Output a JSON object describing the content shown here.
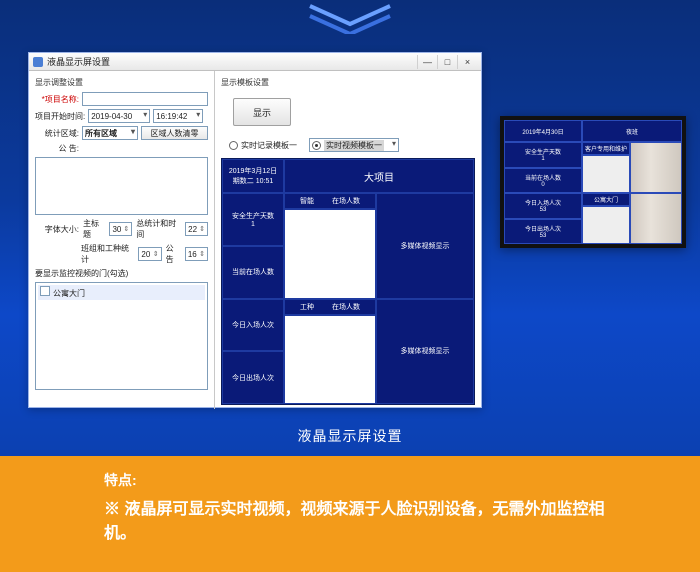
{
  "window": {
    "title": "液晶显示屏设置",
    "minimize": "—",
    "maximize": "□",
    "close": "×"
  },
  "left": {
    "group": "显示调整设置",
    "project_name_lbl": "*项目名称:",
    "date_lbl": "项目开始时间:",
    "date": "2019-04-30",
    "time": "16:19:42",
    "area_lbl": "统计区域:",
    "area": "所有区域",
    "area_clear": "区域人数清零",
    "notice_lbl": "公   告:",
    "fontsize_lbl": "字体大小:",
    "gsb": "主标题",
    "gsb_v": "30",
    "zb": "总统计和时间",
    "zb_v": "22",
    "bz": "班组和工种统计",
    "bz_v": "20",
    "gg": "公告",
    "gg_v": "16",
    "doors_lbl": "要显示监控视频的门(勾选)",
    "door_item": "公寓大门"
  },
  "right": {
    "group": "显示模板设置",
    "show_btn": "显示",
    "radio1": "实时记录模板一",
    "radio2": "实时视频模板一",
    "table": {
      "date1": "2019年3月12日",
      "date2": "期数二 10:51",
      "proj": "大项目",
      "safe": "安全生产天数",
      "safe_v": "1",
      "now": "当前在场人数",
      "inout": "今日入场人次",
      "out": "今日出场人次",
      "bz": "智能",
      "zc": "在场人数",
      "gw": "工种",
      "zc2": "在场人数",
      "mm": "多媒体视频显示"
    }
  },
  "cctv": {
    "date": "2019年4月30日",
    "safe": "安全生产天数",
    "safe_v": "1",
    "now": "当前在场人数",
    "now_v": "0",
    "in": "今日入场人次",
    "in_v": "53",
    "out": "今日出场人次",
    "out_v": "53",
    "hall": "夜班",
    "gate": "公寓大门",
    "unit": "客户专用和维护"
  },
  "caption": "液晶显示屏设置",
  "orange": {
    "ttl": "特点:",
    "body": "※ 液晶屏可显示实时视频，视频来源于人脸识别设备，无需外加监控相机。"
  }
}
